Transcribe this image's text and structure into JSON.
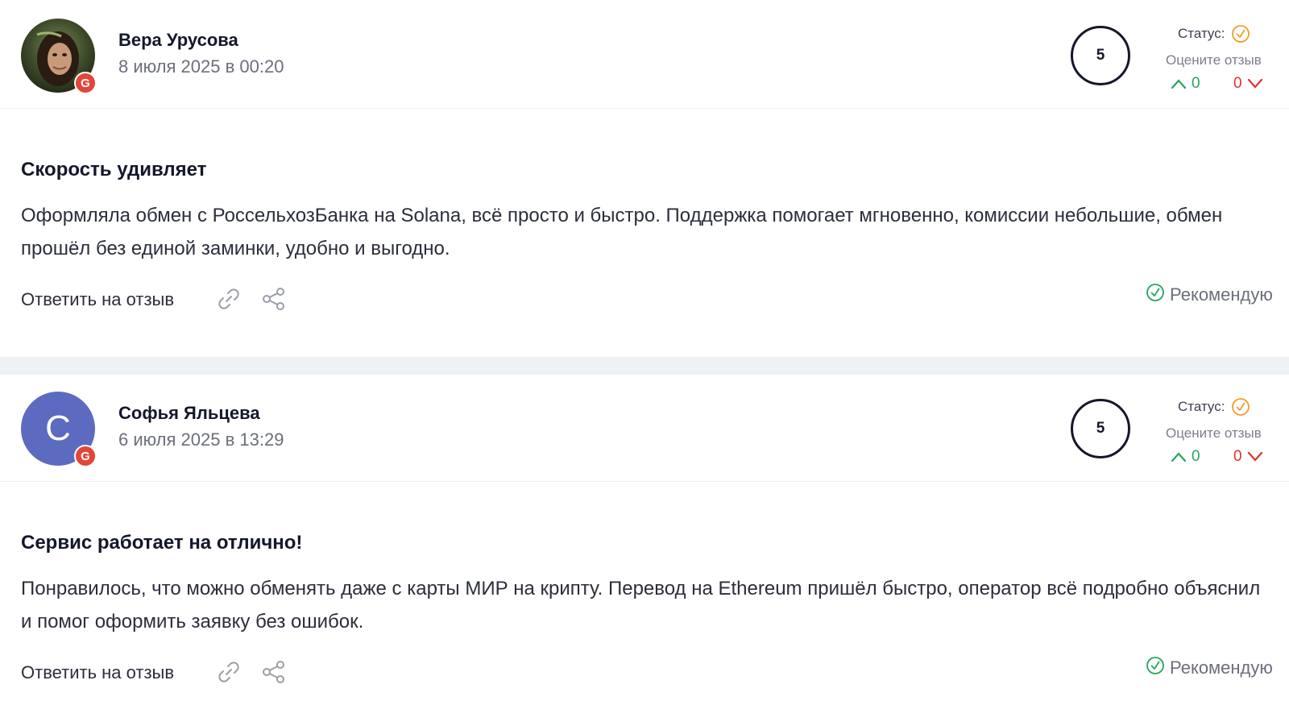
{
  "reviews": [
    {
      "author": "Вера Урусова",
      "date": "8 июля 2025 в 00:20",
      "avatar_letter": "",
      "badge": "G",
      "score": "5",
      "status_label": "Статус:",
      "rate_label": "Оцените отзыв",
      "votes_up": "0",
      "votes_down": "0",
      "title": "Скорость удивляет",
      "text": "Оформляла обмен с РоссельхозБанка на Solana, всё просто и быстро. Поддержка помогает мгновенно, комиссии небольшие, обмен прошёл без единой заминки, удобно и выгодно.",
      "reply_label": "Ответить на отзыв",
      "recommend_label": "Рекомендую"
    },
    {
      "author": "Софья Яльцева",
      "date": "6 июля 2025 в 13:29",
      "avatar_letter": "C",
      "badge": "G",
      "score": "5",
      "status_label": "Статус:",
      "rate_label": "Оцените отзыв",
      "votes_up": "0",
      "votes_down": "0",
      "title": "Сервис работает на отлично!",
      "text": "Понравилось, что можно обменять даже с карты МИР на крипту. Перевод на Ethereum пришёл быстро, оператор всё подробно объяснил и помог оформить заявку без ошибок.",
      "reply_label": "Ответить на отзыв",
      "recommend_label": "Рекомендую"
    }
  ],
  "colors": {
    "status_ok": "#f39c2b",
    "vote_up": "#26a55a",
    "vote_down": "#e0302a",
    "recommend": "#26a55a",
    "avatar_bg": "#5c6bc0",
    "google_badge": "#e2463a"
  }
}
